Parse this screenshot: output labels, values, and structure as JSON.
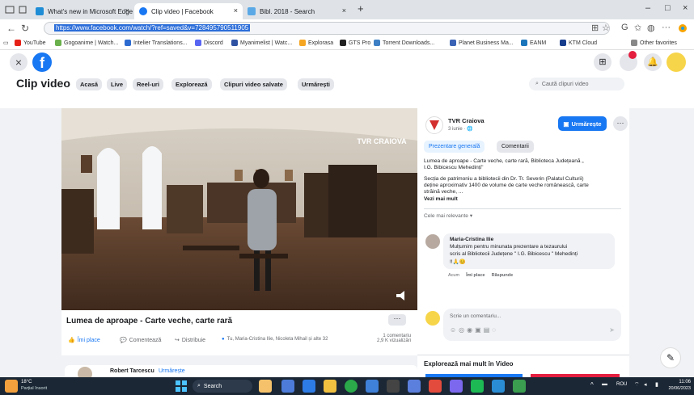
{
  "tabs": [
    {
      "label": "What's new in Microsoft Edge",
      "favicon_color": "#1f8cd6",
      "active": false
    },
    {
      "label": "Clip video | Facebook",
      "favicon_color": "#1877f2",
      "active": true
    },
    {
      "label": "Bibl. 2018 - Search",
      "favicon_color": "#5aa9e6",
      "active": false
    }
  ],
  "address": {
    "url": "https://www.facebook.com/watch/?ref=saved&v=728495790511905"
  },
  "bookmarks": [
    {
      "label": "YouTube",
      "color": "#e62117"
    },
    {
      "label": "Gogoanime | Watch...",
      "color": "#6ab04c"
    },
    {
      "label": "Intelier Translations...",
      "color": "#2d6bd1"
    },
    {
      "label": "Discord",
      "color": "#5865f2"
    },
    {
      "label": "Myanimelist | Watc...",
      "color": "#2e51a2"
    },
    {
      "label": "Explorasa",
      "color": "#f5a623"
    },
    {
      "label": "GTS Pro",
      "color": "#222222"
    },
    {
      "label": "Torrent Downloads...",
      "color": "#3d7fc4"
    },
    {
      "label": "Planet Business Ma...",
      "color": "#3a63b5"
    },
    {
      "label": "EANM",
      "color": "#1b75bb"
    },
    {
      "label": "KTM Cloud",
      "color": "#163c8c"
    },
    {
      "label": "Other favorites",
      "color": "#888888"
    }
  ],
  "clip_nav": {
    "title": "Clip video",
    "pills": [
      "Acasă",
      "Live",
      "Reel-uri",
      "Explorează",
      "Clipuri video salvate",
      "Urmărești"
    ],
    "search_placeholder": "Caută clipuri video"
  },
  "video": {
    "watermark": "TVR CRAIOVA",
    "title": "Lumea de aproape - Carte veche, carte rară",
    "like_label": "Îmi place",
    "comment_label": "Comentează",
    "share_label": "Distribuie",
    "reactions_text": "Tu, Maria-Cristina Ilie, Nicoleta Mihail și alte 32",
    "comments_count": "1 comentariu",
    "views": "2,9 K vizualizări"
  },
  "related": {
    "author": "Robert Tarcescu",
    "follow": "Urmărește"
  },
  "panel": {
    "page_name": "TVR Craiova",
    "page_meta": "3 iunie · 🌐",
    "follow_label": "Urmărește",
    "tab_overview": "Prezentare generală",
    "tab_comments": "Comentarii",
    "desc_1": "Lumea de aproape - Carte veche, carte rară, Biblioteca Județeană „",
    "desc_2": "I.G. Bibicescu Mehedinți\"",
    "desc_3": "Secția de patrimoniu a bibliotecii din Dr. Tr. Severin (Palatul Culturii)",
    "desc_4": "deține aproximativ 1400 de volume de carte veche românească, carte",
    "desc_5": "străină veche, ...",
    "see_more": "Vezi mai mult",
    "sort_label": "Cele mai relevante",
    "comment": {
      "author": "Maria-Cristina Ilie",
      "line1": "Mulțumim pentru minunata prezentare a tezaurului",
      "line2": "scris al Bibliotecii Județene \" I.G. Bibicescu \" Mehedinți",
      "line3": "!!🙏😊",
      "actions": [
        "Acum",
        "Îmi place",
        "Răspunde"
      ]
    },
    "write_comment": "Scrie un comentariu...",
    "explore_more": "Explorează mai mult în Video"
  },
  "taskbar": {
    "weather_temp": "18°C",
    "weather_desc": "Parțial însorit",
    "search": "Search",
    "lang": "ROU",
    "time": "11:06",
    "date": "20/06/2023"
  }
}
